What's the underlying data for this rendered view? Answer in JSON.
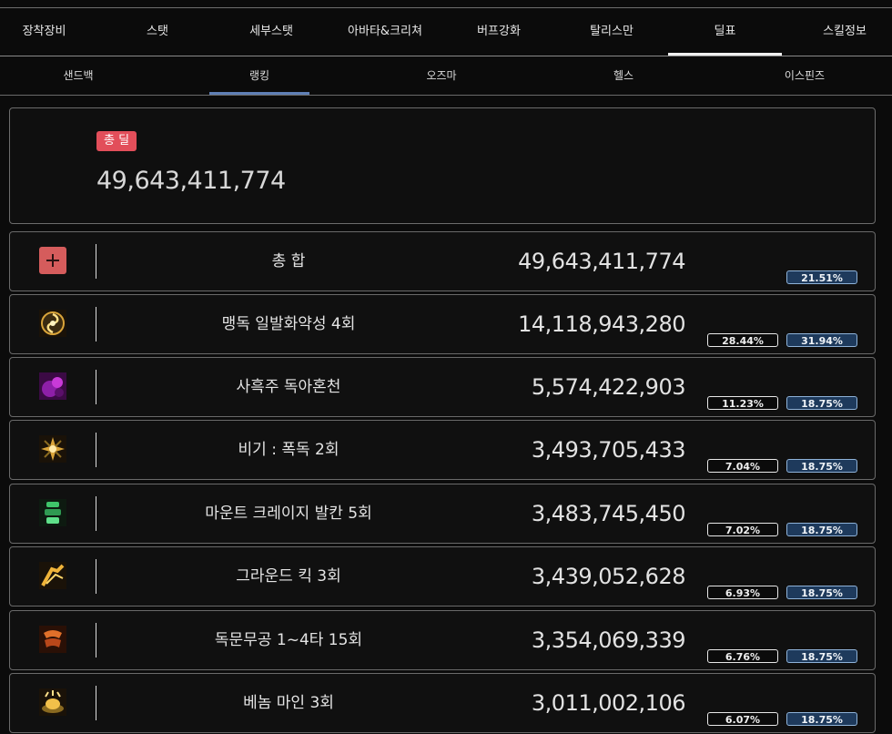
{
  "main_tabs": [
    "장착장비",
    "스탯",
    "세부스탯",
    "아바타&크리쳐",
    "버프강화",
    "탈리스만",
    "딜표",
    "스킬정보"
  ],
  "main_active": "딜표",
  "sub_tabs": [
    "샌드백",
    "랭킹",
    "오즈마",
    "헬스",
    "이스핀즈"
  ],
  "sub_active": "랭킹",
  "summary": {
    "badge": "총 딜",
    "value": "49,643,411,774"
  },
  "rows": [
    {
      "icon": "plus-icon",
      "name": "총 합",
      "damage": "49,643,411,774",
      "share": "",
      "ratio": "21.51%"
    },
    {
      "icon": "swirl-skill-icon",
      "name": "맹독 일발화약성 4회",
      "damage": "14,118,943,280",
      "share": "28.44%",
      "ratio": "31.94%"
    },
    {
      "icon": "purple-curse-skill-icon",
      "name": "사흑주 독아혼천",
      "damage": "5,574,422,903",
      "share": "11.23%",
      "ratio": "18.75%"
    },
    {
      "icon": "burst-skill-icon",
      "name": "비기 : 폭독 2회",
      "damage": "3,493,705,433",
      "share": "7.04%",
      "ratio": "18.75%"
    },
    {
      "icon": "green-mount-skill-icon",
      "name": "마운트 크레이지 발칸 5회",
      "damage": "3,483,745,450",
      "share": "7.02%",
      "ratio": "18.75%"
    },
    {
      "icon": "kick-skill-icon",
      "name": "그라운드 킥 3회",
      "damage": "3,439,052,628",
      "share": "6.93%",
      "ratio": "18.75%"
    },
    {
      "icon": "claw-skill-icon",
      "name": "독문무공 1~4타 15회",
      "damage": "3,354,069,339",
      "share": "6.76%",
      "ratio": "18.75%"
    },
    {
      "icon": "venom-mine-skill-icon",
      "name": "베놈 마인 3회",
      "damage": "3,011,002,106",
      "share": "6.07%",
      "ratio": "18.75%"
    }
  ],
  "colors": {
    "badge": "#e24e5a",
    "ratio_bg": "#1e3a5c",
    "sub_active_underline": "#5f7fb5"
  }
}
